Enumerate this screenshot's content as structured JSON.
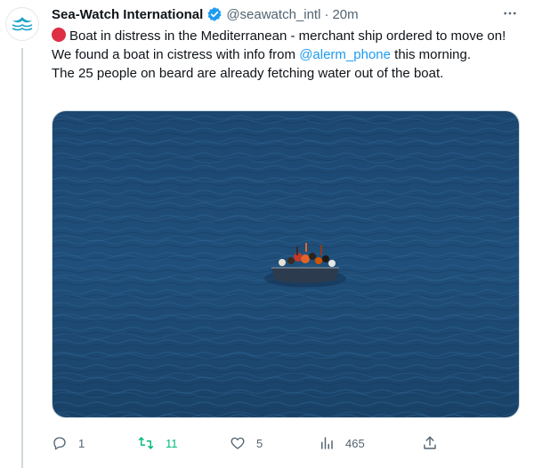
{
  "tweet": {
    "author": {
      "name": "Sea-Watch International",
      "handle": "@seawatch_intl",
      "separator": "·",
      "time": "20m",
      "avatar_icon": "sea-watch-logo-icon",
      "verified_icon": "verified-badge-icon"
    },
    "more_icon": "more-icon",
    "text": {
      "line1_emoji": "red-circle-icon",
      "line1": "Boat in distress in the Mediterranean - merchant ship ordered to move on!",
      "line2_before": "We found a boat in cistress with info from ",
      "line2_mention": "@alerm_phone",
      "line2_after": " this morning.",
      "line3": "The 25 people on beard are already fetching water out of the boat."
    },
    "media": {
      "alt_subject": "small boat with people on open sea"
    },
    "actions": {
      "reply_count": "1",
      "retweet_count": "11",
      "like_count": "5",
      "views_count": "465"
    }
  },
  "colors": {
    "accent": "#1d9bf0",
    "retweet_green": "#00ba7c",
    "muted": "#536471",
    "sea": "#1e4a72",
    "alert_red": "#dd2e44"
  }
}
